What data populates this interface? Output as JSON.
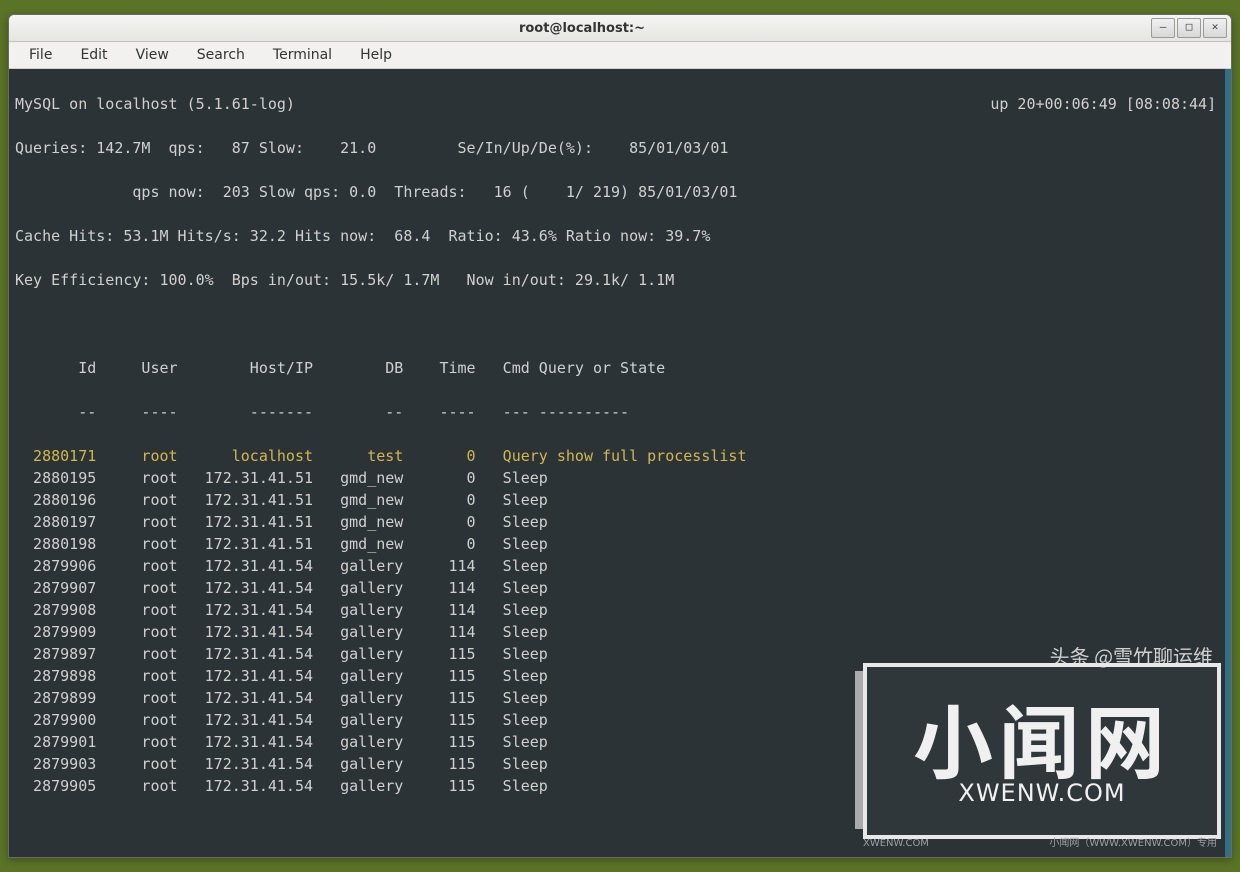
{
  "window": {
    "title": "root@localhost:~"
  },
  "menu": {
    "file": "File",
    "edit": "Edit",
    "view": "View",
    "search": "Search",
    "terminal": "Terminal",
    "help": "Help"
  },
  "stats": {
    "line1": "MySQL on localhost (5.1.61-log)",
    "uptime": "up 20+00:06:49 [08:08:44]",
    "line2": "Queries: 142.7M  qps:   87 Slow:    21.0         Se/In/Up/De(%):    85/01/03/01",
    "line3": "             qps now:  203 Slow qps: 0.0  Threads:   16 (    1/ 219) 85/01/03/01",
    "line4": "Cache Hits: 53.1M Hits/s: 32.2 Hits now:  68.4  Ratio: 43.6% Ratio now: 39.7%",
    "line5": "Key Efficiency: 100.0%  Bps in/out: 15.5k/ 1.7M   Now in/out: 29.1k/ 1.1M"
  },
  "columns": {
    "id": "Id",
    "user": "User",
    "host": "Host/IP",
    "db": "DB",
    "time": "Time",
    "cmd": "Cmd Query or State"
  },
  "rows": [
    {
      "hl": true,
      "id": "2880171",
      "user": "root",
      "host": "localhost",
      "db": "test",
      "time": "0",
      "cmd": "Query show full processlist"
    },
    {
      "hl": false,
      "id": "2880195",
      "user": "root",
      "host": "172.31.41.51",
      "db": "gmd_new",
      "time": "0",
      "cmd": "Sleep"
    },
    {
      "hl": false,
      "id": "2880196",
      "user": "root",
      "host": "172.31.41.51",
      "db": "gmd_new",
      "time": "0",
      "cmd": "Sleep"
    },
    {
      "hl": false,
      "id": "2880197",
      "user": "root",
      "host": "172.31.41.51",
      "db": "gmd_new",
      "time": "0",
      "cmd": "Sleep"
    },
    {
      "hl": false,
      "id": "2880198",
      "user": "root",
      "host": "172.31.41.51",
      "db": "gmd_new",
      "time": "0",
      "cmd": "Sleep"
    },
    {
      "hl": false,
      "id": "2879906",
      "user": "root",
      "host": "172.31.41.54",
      "db": "gallery",
      "time": "114",
      "cmd": "Sleep"
    },
    {
      "hl": false,
      "id": "2879907",
      "user": "root",
      "host": "172.31.41.54",
      "db": "gallery",
      "time": "114",
      "cmd": "Sleep"
    },
    {
      "hl": false,
      "id": "2879908",
      "user": "root",
      "host": "172.31.41.54",
      "db": "gallery",
      "time": "114",
      "cmd": "Sleep"
    },
    {
      "hl": false,
      "id": "2879909",
      "user": "root",
      "host": "172.31.41.54",
      "db": "gallery",
      "time": "114",
      "cmd": "Sleep"
    },
    {
      "hl": false,
      "id": "2879897",
      "user": "root",
      "host": "172.31.41.54",
      "db": "gallery",
      "time": "115",
      "cmd": "Sleep"
    },
    {
      "hl": false,
      "id": "2879898",
      "user": "root",
      "host": "172.31.41.54",
      "db": "gallery",
      "time": "115",
      "cmd": "Sleep"
    },
    {
      "hl": false,
      "id": "2879899",
      "user": "root",
      "host": "172.31.41.54",
      "db": "gallery",
      "time": "115",
      "cmd": "Sleep"
    },
    {
      "hl": false,
      "id": "2879900",
      "user": "root",
      "host": "172.31.41.54",
      "db": "gallery",
      "time": "115",
      "cmd": "Sleep"
    },
    {
      "hl": false,
      "id": "2879901",
      "user": "root",
      "host": "172.31.41.54",
      "db": "gallery",
      "time": "115",
      "cmd": "Sleep"
    },
    {
      "hl": false,
      "id": "2879903",
      "user": "root",
      "host": "172.31.41.54",
      "db": "gallery",
      "time": "115",
      "cmd": "Sleep"
    },
    {
      "hl": false,
      "id": "2879905",
      "user": "root",
      "host": "172.31.41.54",
      "db": "gallery",
      "time": "115",
      "cmd": "Sleep"
    }
  ],
  "watermark": {
    "big": "小闻网",
    "sub": "XWENW.COM",
    "byline": "头条 @雪竹聊运维",
    "footer1": "XWENW.COM",
    "footer2": "小闻网（WWW.XWENW.COM）专用"
  }
}
